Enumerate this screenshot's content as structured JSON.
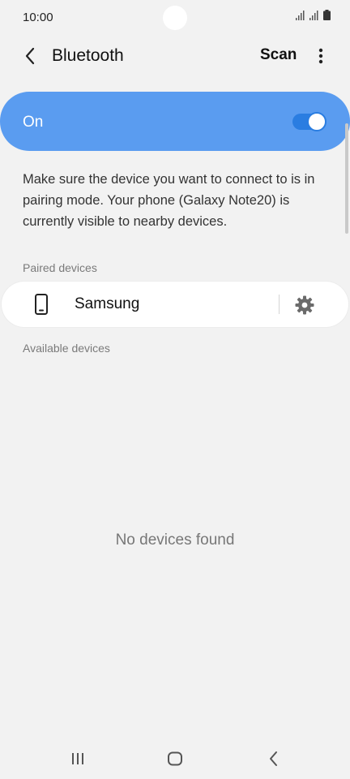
{
  "status_bar": {
    "time": "10:00",
    "icons": [
      "signal-icon",
      "signal-icon",
      "battery-icon"
    ]
  },
  "header": {
    "back_icon": "chevron-left-icon",
    "title": "Bluetooth",
    "scan_label": "Scan",
    "more_icon": "more-vertical-icon"
  },
  "bluetooth_toggle": {
    "label": "On",
    "enabled": true
  },
  "info_text": "Make sure the device you want to connect to is in pairing mode. Your phone (Galaxy Note20) is currently visible to nearby devices.",
  "paired": {
    "header": "Paired devices",
    "devices": [
      {
        "name": "Samsung",
        "icon": "phone-icon",
        "settings_icon": "gear-icon"
      }
    ]
  },
  "available": {
    "header": "Available devices",
    "empty_message": "No devices found"
  },
  "navigation": {
    "buttons": [
      "recent-apps-icon",
      "home-icon",
      "back-icon"
    ]
  },
  "colors": {
    "accent": "#5a9cf0",
    "switch": "#2a7de1",
    "background": "#f2f2f2"
  }
}
